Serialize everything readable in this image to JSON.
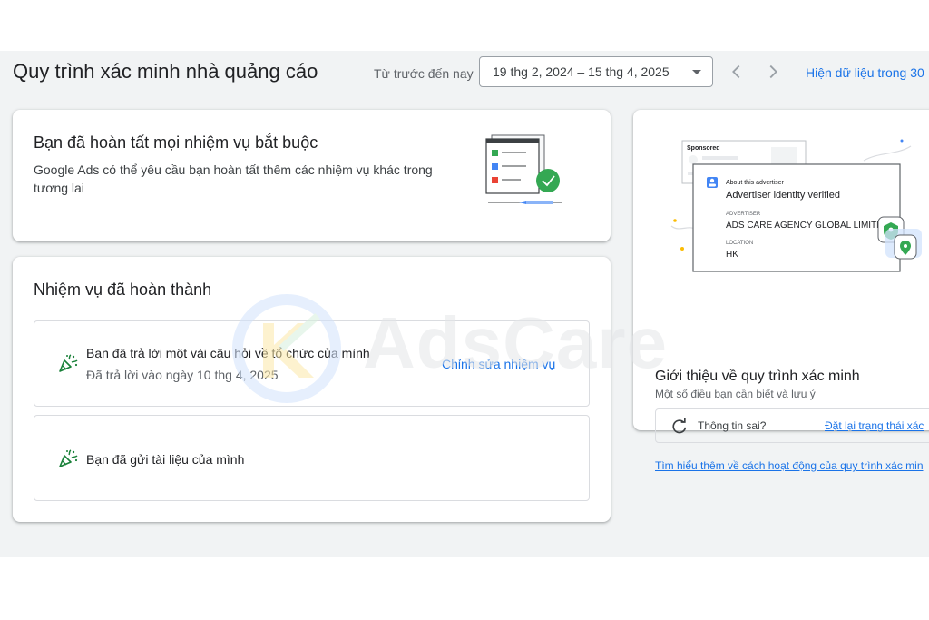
{
  "header": {
    "page_title": "Quy trình xác minh nhà quảng cáo",
    "range_caption": "Từ trước đến nay",
    "date_range": "19 thg 2, 2024 – 15 thg 4, 2025",
    "show_data_label": "Hiện dữ liệu trong 30"
  },
  "completed_card": {
    "title": "Bạn đã hoàn tất mọi nhiệm vụ bắt buộc",
    "description": "Google Ads có thể yêu cầu bạn hoàn tất thêm các nhiệm vụ khác trong tương lai"
  },
  "tasks_card": {
    "title": "Nhiệm vụ đã hoàn thành",
    "tasks": [
      {
        "title": "Bạn đã trả lời một vài câu hỏi về tổ chức của mình",
        "subtitle": "Đã trả lời vào ngày 10 thg 4, 2025",
        "action": "Chỉnh sửa nhiệm vụ"
      },
      {
        "title": "Bạn đã gửi tài liệu của mình"
      }
    ]
  },
  "intro_card": {
    "illustration": {
      "sponsored": "Sponsored",
      "about": "About this advertiser",
      "verified": "Advertiser identity verified",
      "advertiser_label": "ADVERTISER",
      "advertiser_name": "ADS CARE AGENCY GLOBAL LIMITED",
      "location_label": "LOCATION",
      "location_value": "HK"
    },
    "title": "Giới thiệu về quy trình xác minh",
    "subtitle": "Một số điều bạn cần biết và lưu ý",
    "info_question": "Thông tin sai?",
    "reset_link": "Đặt lại trạng thái xác",
    "learn_more": "Tìm hiểu thêm về cách hoạt động của quy trình xác min"
  },
  "watermark": {
    "text": "AdsCare"
  },
  "icons": {
    "date_caret": "chevron-down-icon",
    "prev": "chevron-left-icon",
    "next": "chevron-right-icon",
    "task_done": "party-popper-icon",
    "refresh": "refresh-icon"
  },
  "colors": {
    "link": "#1a73e8",
    "success_green": "#34a853",
    "page_bg": "#f1f3f4",
    "card_bg": "#ffffff"
  }
}
